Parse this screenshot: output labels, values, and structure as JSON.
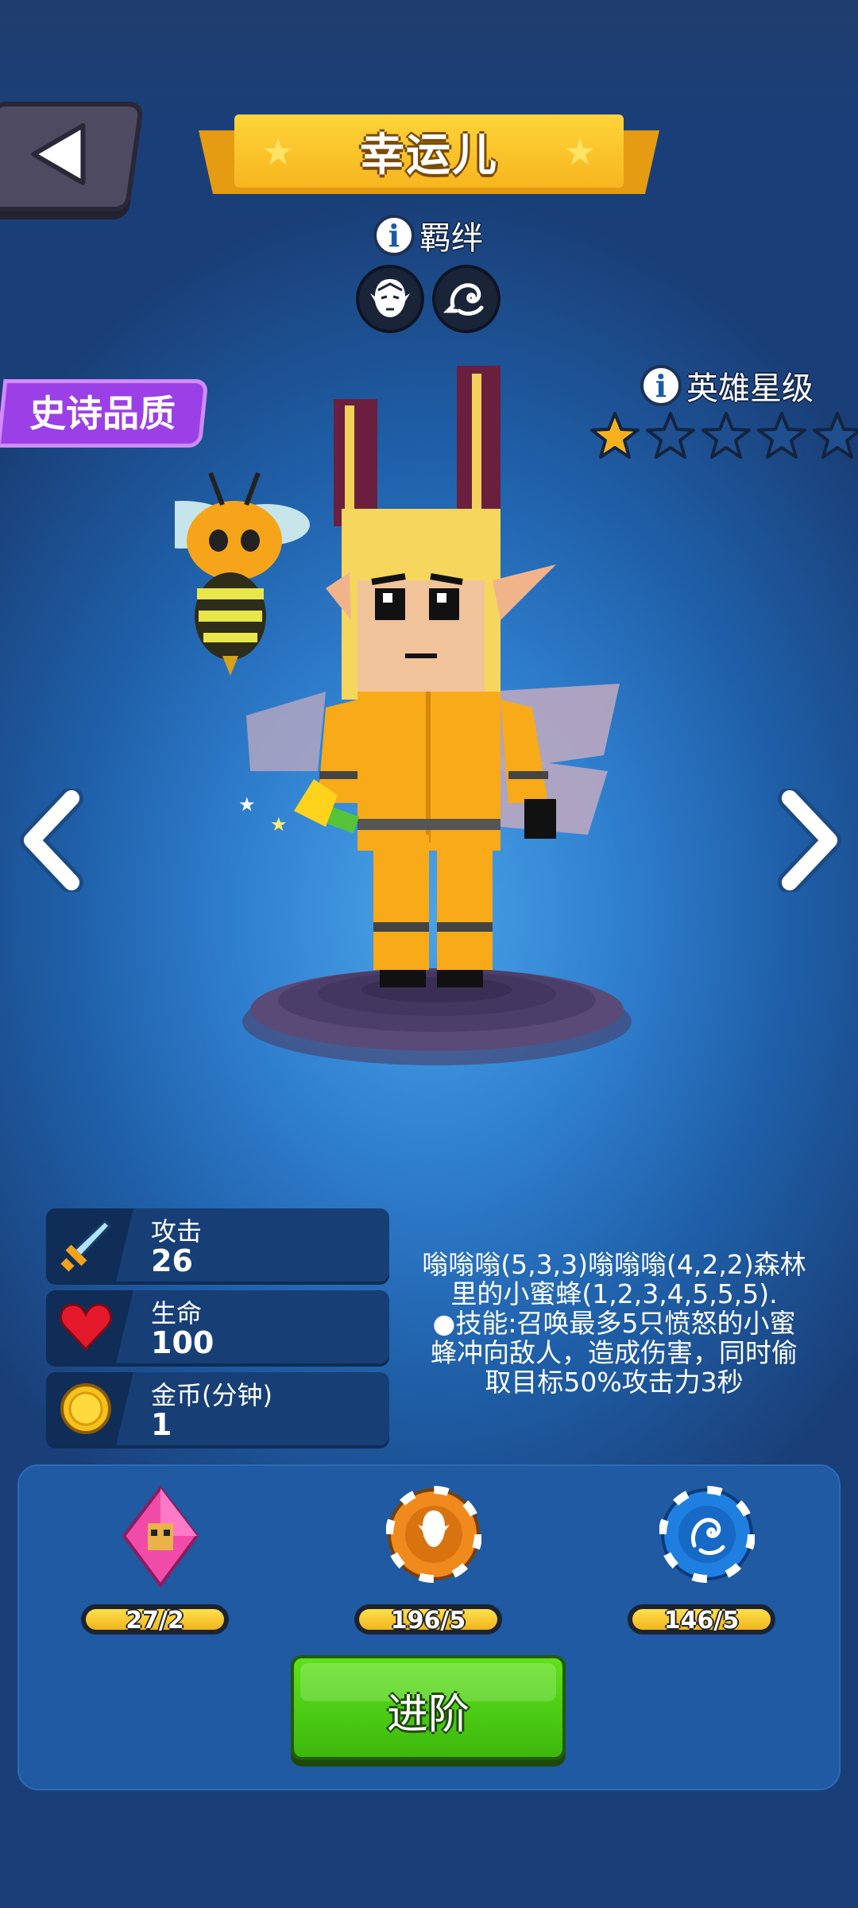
{
  "hero": {
    "name": "幸运儿",
    "quality": "史诗品质"
  },
  "bond": {
    "label": "羁绊",
    "icons": [
      "elf-portrait-icon",
      "dragon-emblem-icon"
    ]
  },
  "star_level": {
    "label": "英雄星级",
    "filled": 1,
    "total": 5
  },
  "stats": [
    {
      "label": "攻击",
      "value": "26",
      "icon": "sword-icon"
    },
    {
      "label": "生命",
      "value": "100",
      "icon": "heart-icon"
    },
    {
      "label": "金币(分钟)",
      "value": "1",
      "icon": "gold-coin-icon"
    }
  ],
  "description": {
    "line1": "嗡嗡嗡(5,3,3)嗡嗡嗡(4,2,2)森林",
    "line2": "里的小蜜蜂(1,2,3,4,5,5,5).",
    "line3": "●技能:召唤最多5只愤怒的小蜜",
    "line4": "蜂冲向敌人，造成伤害，同时偷",
    "line5": "取目标50%攻击力3秒"
  },
  "materials": [
    {
      "count": "27/2",
      "icon": "hero-shard-gem-icon"
    },
    {
      "count": "196/5",
      "icon": "elf-chip-icon"
    },
    {
      "count": "146/5",
      "icon": "dragon-chip-icon"
    }
  ],
  "advance_button": {
    "label": "进阶"
  },
  "colors": {
    "quality_purple": "#9b40e6",
    "star_gold": "#f6b21c",
    "advance_green": "#4fcc14"
  }
}
